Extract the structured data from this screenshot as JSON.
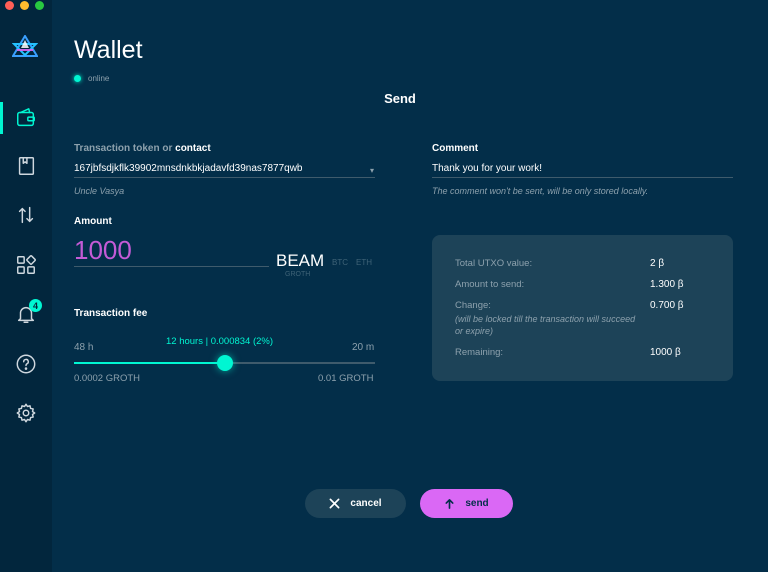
{
  "window": {
    "title": "Wallet",
    "status": "online"
  },
  "sidebar": {
    "items": [
      {
        "name": "wallet",
        "active": true
      },
      {
        "name": "address-book"
      },
      {
        "name": "utxo"
      },
      {
        "name": "dashboard"
      },
      {
        "name": "notifications",
        "badge": "4"
      },
      {
        "name": "help"
      },
      {
        "name": "settings"
      }
    ]
  },
  "send": {
    "heading": "Send",
    "token_label_prefix": "Transaction token or",
    "token_label_contact": "contact",
    "token_value": "167jbfsdjkflk39902mnsdnkbkjadavfd39nas7877qwb",
    "contact_name": "Uncle Vasya",
    "comment_label": "Comment",
    "comment_value": "Thank you for your work!",
    "comment_hint": "The comment won't be sent, will be only stored locally.",
    "amount_label": "Amount",
    "amount_value": "1000",
    "currency": "BEAM",
    "currency_alt_1": "BTC",
    "currency_alt_2": "ETH",
    "currency_sub": "GROTH",
    "fee_label": "Transaction fee",
    "fee_current": "12 hours  |  0.000834 (2%)",
    "fee_left_time": "48 h",
    "fee_right_time": "20 m",
    "fee_min": "0.0002 GROTH",
    "fee_max": "0.01 GROTH",
    "fee_slider_fraction": 0.5
  },
  "summary": {
    "total_label": "Total UTXO value:",
    "total_value": "2 β",
    "amount_label": "Amount to send:",
    "amount_value": "1.300 β",
    "change_label": "Change:",
    "change_note": "(will be locked till the transaction will succeed or expire)",
    "change_value": "0.700 β",
    "remaining_label": "Remaining:",
    "remaining_value": "1000 β"
  },
  "actions": {
    "cancel_label": "cancel",
    "send_label": "send"
  },
  "colors": {
    "accent": "#00f6d2",
    "amount": "#c45bd6",
    "send_button": "#da68f5",
    "background": "#032e49",
    "sidebar": "#02263d"
  }
}
